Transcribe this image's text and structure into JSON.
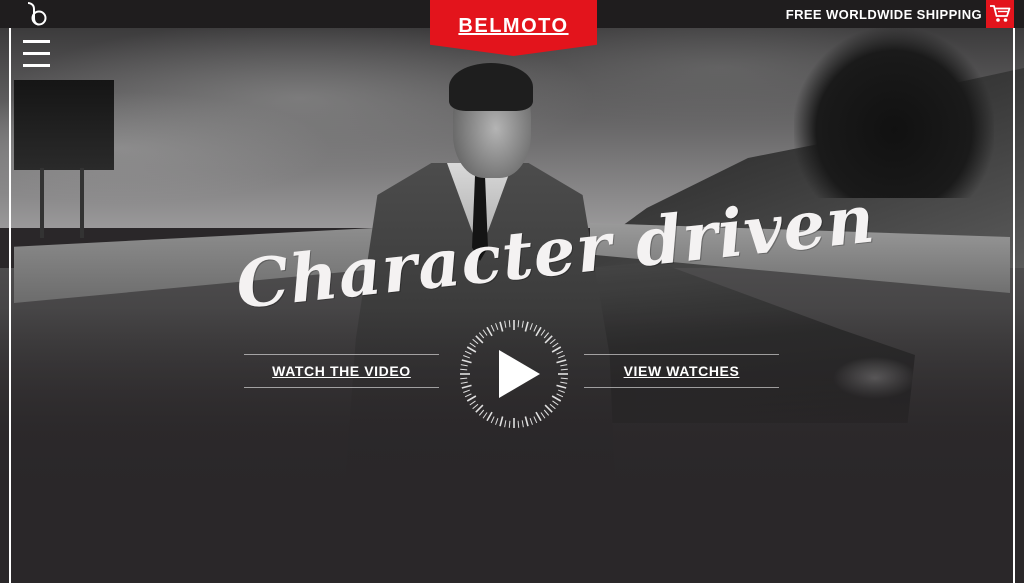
{
  "topbar": {
    "brand": "BELMOTO",
    "shipping_text": "FREE WORLDWIDE SHIPPING",
    "logo_icon": "belmoto-b-logo-icon",
    "cart_icon": "shopping-cart-icon"
  },
  "hero": {
    "headline": "Character driven",
    "watch_video_label": "WATCH THE VIDEO",
    "view_watches_label": "VIEW WATCHES",
    "play_icon": "play-icon"
  },
  "colors": {
    "accent": "#e3141c",
    "background": "#2a2729",
    "topbar": "#1f1d1e",
    "text": "#ffffff"
  }
}
